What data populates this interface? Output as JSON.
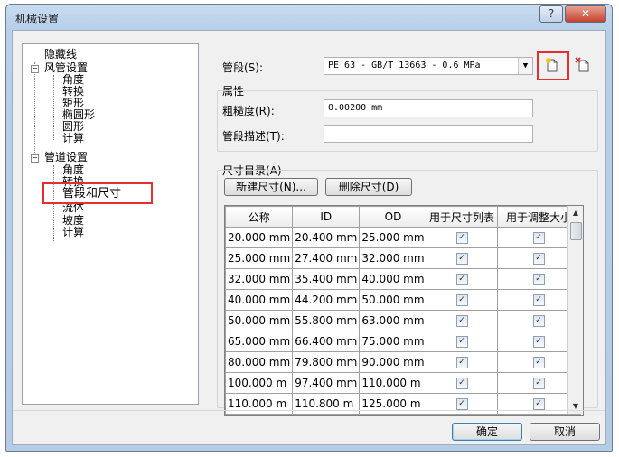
{
  "window": {
    "title": "机械设置",
    "help_label": "?",
    "close_label": "✕"
  },
  "tree": {
    "items": [
      {
        "label": "隐藏线"
      },
      {
        "label": "风管设置",
        "expander": "−"
      },
      {
        "label": "角度"
      },
      {
        "label": "转换"
      },
      {
        "label": "矩形"
      },
      {
        "label": "椭圆形"
      },
      {
        "label": "圆形"
      },
      {
        "label": "计算"
      },
      {
        "label": "管道设置",
        "expander": "−"
      },
      {
        "label": "角度"
      },
      {
        "label": "转换"
      },
      {
        "label": "管段和尺寸"
      },
      {
        "label": "流体"
      },
      {
        "label": "坡度"
      },
      {
        "label": "计算"
      }
    ]
  },
  "pipe_segment": {
    "label": "管段(S):",
    "value": "PE 63 - GB/T 13663 - 0.6 MPa",
    "arrow": "▼"
  },
  "properties": {
    "heading": "属性",
    "roughness_label": "粗糙度(R):",
    "roughness_value": "0.00200 mm",
    "description_label": "管段描述(T):",
    "description_value": ""
  },
  "sizes": {
    "heading": "尺寸目录(A)",
    "new_button": "新建尺寸(N)...",
    "delete_button": "删除尺寸(D)",
    "columns": [
      "公称",
      "ID",
      "OD",
      "用于尺寸列表",
      "用于调整大小"
    ],
    "rows": [
      [
        "20.000 mm",
        "20.400 mm",
        "25.000 mm"
      ],
      [
        "25.000 mm",
        "27.400 mm",
        "32.000 mm"
      ],
      [
        "32.000 mm",
        "35.400 mm",
        "40.000 mm"
      ],
      [
        "40.000 mm",
        "44.200 mm",
        "50.000 mm"
      ],
      [
        "50.000 mm",
        "55.800 mm",
        "63.000 mm"
      ],
      [
        "65.000 mm",
        "66.400 mm",
        "75.000 mm"
      ],
      [
        "80.000 mm",
        "79.800 mm",
        "90.000 mm"
      ],
      [
        "100.000 m",
        "97.400 mm",
        "110.000 m"
      ],
      [
        "110.000 m",
        "110.800 m",
        "125.000 m"
      ]
    ],
    "check_mark": "✓"
  },
  "footer": {
    "ok_button": "确定",
    "cancel_button": "取消"
  },
  "colors": {
    "highlight": "#e23030"
  }
}
